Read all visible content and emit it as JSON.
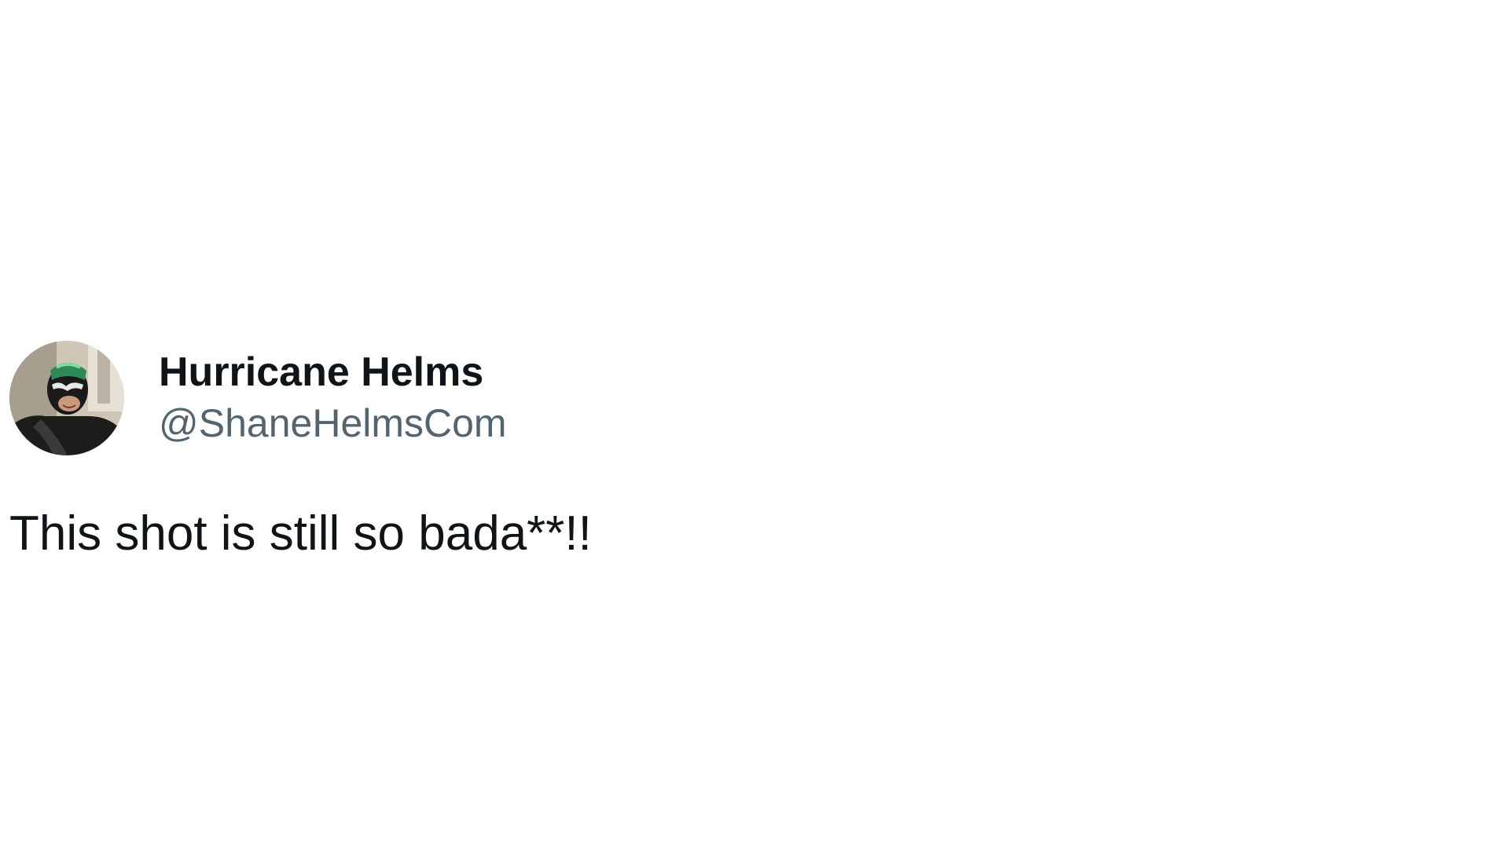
{
  "tweet": {
    "author": {
      "display_name": "Hurricane Helms",
      "handle": "@ShaneHelmsCom",
      "avatar_icon": "profile-photo-masked-wrestler"
    },
    "text": "This shot is still so bada**!!"
  },
  "colors": {
    "background": "#ffffff",
    "primary_text": "#0f1419",
    "secondary_text": "#536471"
  }
}
